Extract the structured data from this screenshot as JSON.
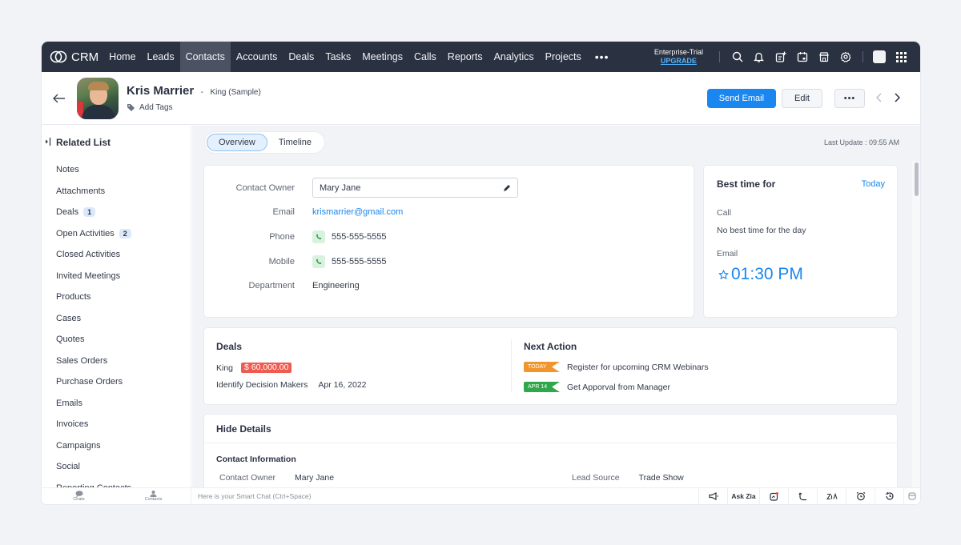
{
  "app": {
    "name": "CRM"
  },
  "nav": {
    "items": [
      {
        "label": "Home",
        "active": false
      },
      {
        "label": "Leads",
        "active": false
      },
      {
        "label": "Contacts",
        "active": true
      },
      {
        "label": "Accounts",
        "active": false
      },
      {
        "label": "Deals",
        "active": false
      },
      {
        "label": "Tasks",
        "active": false
      },
      {
        "label": "Meetings",
        "active": false
      },
      {
        "label": "Calls",
        "active": false
      },
      {
        "label": "Reports",
        "active": false
      },
      {
        "label": "Analytics",
        "active": false
      },
      {
        "label": "Projects",
        "active": false
      }
    ],
    "more_label": "•••",
    "plan": "Enterprise-Trial",
    "upgrade_label": "UPGRADE",
    "icons": [
      "search-icon",
      "bell-icon",
      "add-note-icon",
      "calendar-icon",
      "marketplace-icon",
      "gear-icon",
      "profile-avatar",
      "apps-grid-icon"
    ]
  },
  "header": {
    "contact_name": "Kris Marrier",
    "account": "King (Sample)",
    "separator": "-",
    "add_tags_label": "Add Tags",
    "send_email_label": "Send Email",
    "edit_label": "Edit",
    "more_label": "•••",
    "prev_icon": "chevron-left-icon",
    "next_icon": "chevron-right-icon"
  },
  "sidebar": {
    "title": "Related List",
    "items": [
      {
        "label": "Notes",
        "count": null
      },
      {
        "label": "Attachments",
        "count": null
      },
      {
        "label": "Deals",
        "count": "1"
      },
      {
        "label": "Open Activities",
        "count": "2"
      },
      {
        "label": "Closed Activities",
        "count": null
      },
      {
        "label": "Invited Meetings",
        "count": null
      },
      {
        "label": "Products",
        "count": null
      },
      {
        "label": "Cases",
        "count": null
      },
      {
        "label": "Quotes",
        "count": null
      },
      {
        "label": "Sales Orders",
        "count": null
      },
      {
        "label": "Purchase Orders",
        "count": null
      },
      {
        "label": "Emails",
        "count": null
      },
      {
        "label": "Invoices",
        "count": null
      },
      {
        "label": "Campaigns",
        "count": null
      },
      {
        "label": "Social",
        "count": null
      },
      {
        "label": "Reporting Contacts",
        "count": null
      }
    ]
  },
  "main": {
    "tabs": [
      {
        "label": "Overview",
        "active": true
      },
      {
        "label": "Timeline",
        "active": false
      }
    ],
    "last_update": "Last Update : 09:55 AM",
    "info": {
      "contact_owner_label": "Contact Owner",
      "contact_owner": "Mary Jane",
      "email_label": "Email",
      "email": "krismarrier@gmail.com",
      "phone_label": "Phone",
      "phone": "555-555-5555",
      "mobile_label": "Mobile",
      "mobile": "555-555-5555",
      "department_label": "Department",
      "department": "Engineering"
    },
    "best_time": {
      "title": "Best time for",
      "period": "Today",
      "call_label": "Call",
      "call_text": "No best time for the day",
      "email_label": "Email",
      "email_time": "01:30 PM"
    },
    "deals": {
      "title": "Deals",
      "name": "King",
      "amount": "$ 60,000.00",
      "stage": "Identify Decision Makers",
      "date": "Apr 16, 2022"
    },
    "next_action": {
      "title": "Next Action",
      "items": [
        {
          "tag": "TODAY",
          "color": "#f0962e",
          "text": "Register for upcoming CRM Webinars"
        },
        {
          "tag": "APR 14",
          "color": "#2fa74a",
          "text": "Get Apporval from Manager"
        }
      ]
    },
    "details": {
      "toggle_label": "Hide Details",
      "section": "Contact Information",
      "fields": [
        {
          "label": "Contact Owner",
          "value": "Mary Jane"
        },
        {
          "label": "Lead Source",
          "value": "Trade Show"
        }
      ]
    }
  },
  "bottombar": {
    "chats_label": "Chats",
    "contacts_label": "Contacts",
    "smartchat_placeholder": "Here is your Smart Chat (Ctrl+Space)",
    "ask_zia_label": "Ask Zia"
  },
  "colors": {
    "nav_bg": "#2a3140",
    "accent": "#1a86f0",
    "amount_badge": "#ef5b4f",
    "today_flag": "#f0962e",
    "date_flag": "#2fa74a"
  }
}
